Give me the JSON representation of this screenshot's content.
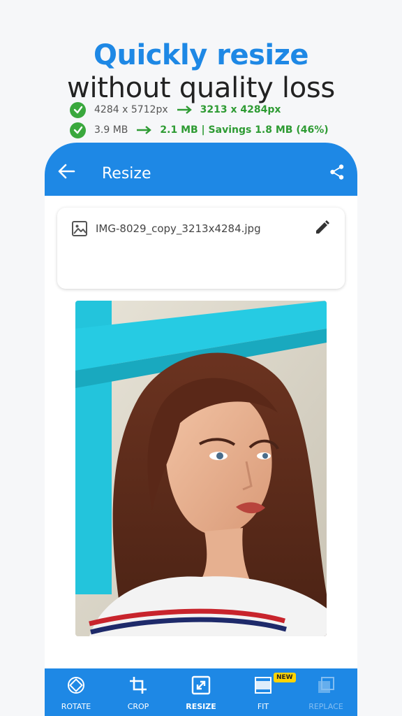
{
  "headline": {
    "line1": "Quickly resize",
    "line2": "without quality loss"
  },
  "appbar": {
    "title": "Resize",
    "back_icon": "arrow-left-icon",
    "share_icon": "share-icon"
  },
  "file_info": {
    "filename": "IMG-8029_copy_3213x4284.jpg",
    "dimensions": {
      "before": "4284 x 5712px",
      "after": "3213 x 4284px"
    },
    "size": {
      "before": "3.9 MB",
      "after": "2.1 MB | Savings 1.8 MB (46%)"
    }
  },
  "toolbar": {
    "items": [
      {
        "label": "ROTATE",
        "icon": "rotate-icon"
      },
      {
        "label": "CROP",
        "icon": "crop-icon"
      },
      {
        "label": "RESIZE",
        "icon": "resize-icon"
      },
      {
        "label": "FIT",
        "icon": "fit-icon",
        "badge": "NEW"
      },
      {
        "label": "REPLACE",
        "icon": "replace-icon"
      }
    ]
  },
  "colors": {
    "accent": "#1e88e5",
    "success": "#3aa83d",
    "badge": "#ffd400"
  }
}
